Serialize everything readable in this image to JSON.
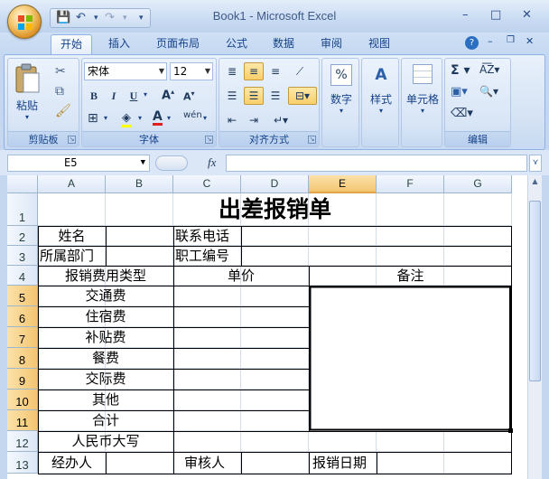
{
  "window": {
    "title": "Book1 - Microsoft Excel",
    "controls": [
      "–",
      "□",
      "✕"
    ]
  },
  "quick_access": {
    "save": "💾",
    "undo": "↶",
    "redo": "↷",
    "more": "▾"
  },
  "tabs": [
    "开始",
    "插入",
    "页面布局",
    "公式",
    "数据",
    "审阅",
    "视图"
  ],
  "active_tab": "开始",
  "ribbon": {
    "clipboard": {
      "label": "剪贴板",
      "paste": "粘贴"
    },
    "font": {
      "label": "字体",
      "font_name": "宋体",
      "font_size": "12",
      "bold": "B",
      "italic": "I",
      "underline": "U"
    },
    "alignment": {
      "label": "对齐方式"
    },
    "number": {
      "label": "数字"
    },
    "styles": {
      "label": "样式"
    },
    "cells": {
      "label": "单元格"
    },
    "editing": {
      "label": "编辑"
    }
  },
  "formula_bar": {
    "name_box": "E5",
    "fx": "fx",
    "content": ""
  },
  "columns": [
    "A",
    "B",
    "C",
    "D",
    "E",
    "F",
    "G"
  ],
  "selected_column": "E",
  "rows": [
    "1",
    "2",
    "3",
    "4",
    "5",
    "6",
    "7",
    "8",
    "9",
    "10",
    "11",
    "12",
    "13"
  ],
  "selected_rows": [
    "5",
    "6",
    "7",
    "8",
    "9",
    "10",
    "11"
  ],
  "sheet": {
    "title": "出差报销单",
    "name_label": "姓名",
    "phone_label": "联系电话",
    "dept_label": "所属部门",
    "staff_no_label": "职工编号",
    "type_header": "报销费用类型",
    "price_header": "单价",
    "note_header": "备注",
    "items": [
      "交通费",
      "住宿费",
      "补贴费",
      "餐费",
      "交际费",
      "其他",
      "合计"
    ],
    "rmb_label": "人民币大写",
    "handler_label": "经办人",
    "reviewer_label": "审核人",
    "date_label": "报销日期"
  },
  "colors": {
    "accent": "#f4c572",
    "ribbon": "#d7e4f5",
    "grid": "#d4dce8"
  }
}
